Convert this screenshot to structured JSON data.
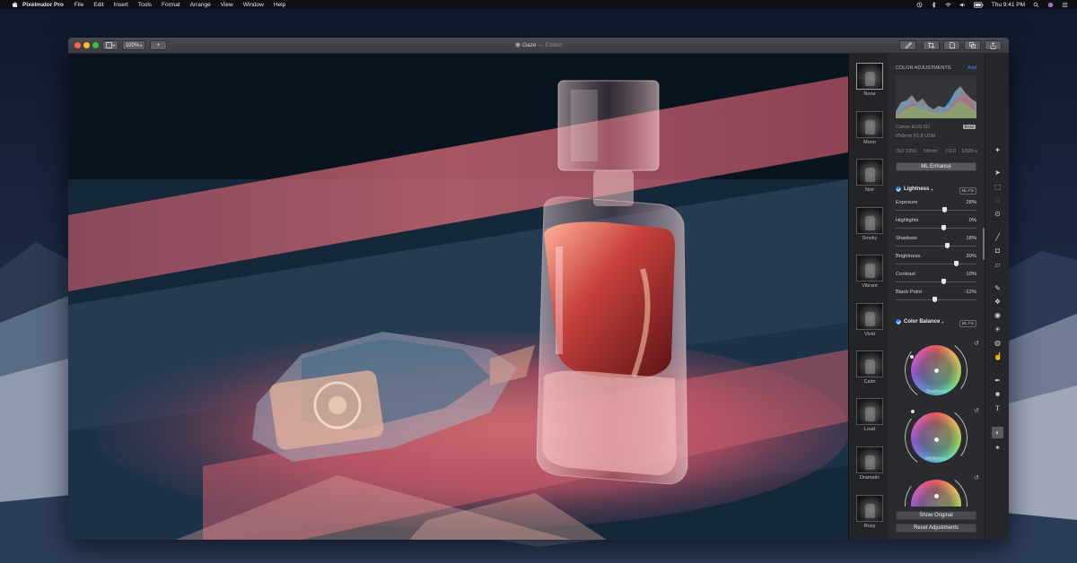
{
  "menubar": {
    "app_name": "Pixelmator Pro",
    "menus": [
      "File",
      "Edit",
      "Insert",
      "Tools",
      "Format",
      "Arrange",
      "View",
      "Window",
      "Help"
    ],
    "clock": "Thu 9:41 PM"
  },
  "window": {
    "title": "Gaze",
    "title_status": "— Edited",
    "zoom": "100%",
    "add_label": "+"
  },
  "presets": [
    {
      "label": "None"
    },
    {
      "label": "Mono"
    },
    {
      "label": "Noir"
    },
    {
      "label": "Smoky"
    },
    {
      "label": "Vibrant"
    },
    {
      "label": "Vivid"
    },
    {
      "label": "Calm"
    },
    {
      "label": "Loud"
    },
    {
      "label": "Dramatic"
    },
    {
      "label": "Rosy"
    }
  ],
  "adjustments": {
    "header": "COLOR ADJUSTMENTS",
    "add": "Add",
    "camera": "Canon EOS 6D",
    "raw_badge": "RAW",
    "lens": "f/50mm f/1.8 USM",
    "iso": "ISO 1250",
    "focal": "50mm",
    "aperture": "ƒ/2.0",
    "shutter": "1/320 s",
    "ml_enhance": "ML Enhance",
    "lightness": {
      "title": "Lightness",
      "badge": "ML Fix",
      "sliders": [
        {
          "name": "Exposure",
          "value": "28%",
          "level": 0.61
        },
        {
          "name": "Highlights",
          "value": "0%",
          "level": 0.59
        },
        {
          "name": "Shadows",
          "value": "18%",
          "level": 0.64
        },
        {
          "name": "Brightness",
          "value": "39%",
          "level": 0.75
        },
        {
          "name": "Contrast",
          "value": "10%",
          "level": 0.59
        },
        {
          "name": "Black Point",
          "value": "-12%",
          "level": 0.48
        }
      ]
    },
    "color_balance": {
      "title": "Color Balance",
      "badge": "ML Fix",
      "wheels": [
        {
          "label": "Shadows"
        },
        {
          "label": "Midtones"
        }
      ]
    },
    "show_original": "Show Original",
    "reset": "Reset Adjustments"
  },
  "colors": {
    "accent": "#2f7de1",
    "panel": "#2a2b2e",
    "titlebar": "#3b3c40"
  }
}
